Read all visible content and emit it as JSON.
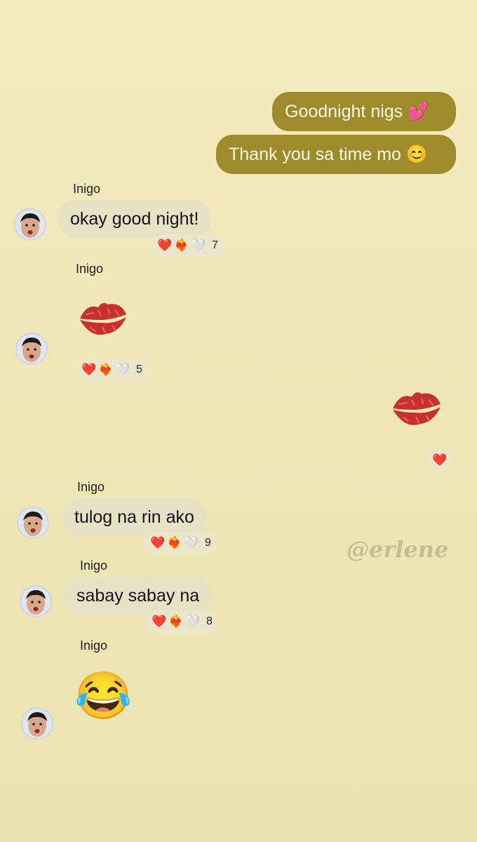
{
  "outgoing": [
    {
      "text": "Goodnight nigs 💕"
    },
    {
      "text": "Thank you sa time mo 😊"
    }
  ],
  "sender_name": "Inigo",
  "incoming": [
    {
      "text": "okay good night!",
      "reaction_count": "7"
    },
    {
      "type": "sticker",
      "sticker": "kiss-mark",
      "reaction_count": "5"
    },
    {
      "text": "tulog na rin ako",
      "reaction_count": "9"
    },
    {
      "text": "sabay sabay na",
      "reaction_count": "8"
    },
    {
      "type": "emoji",
      "emoji": "😂"
    }
  ],
  "outgoing_sticker": {
    "sticker": "kiss-mark",
    "reaction": "❤️"
  },
  "reactions": [
    "❤️",
    "❤️‍🔥",
    "🤍"
  ],
  "watermark": "@erlene",
  "colors": {
    "outgoing_bubble": "#9e8b2b",
    "incoming_bubble": "#e7e2c5",
    "background": "#f0e8b8"
  }
}
